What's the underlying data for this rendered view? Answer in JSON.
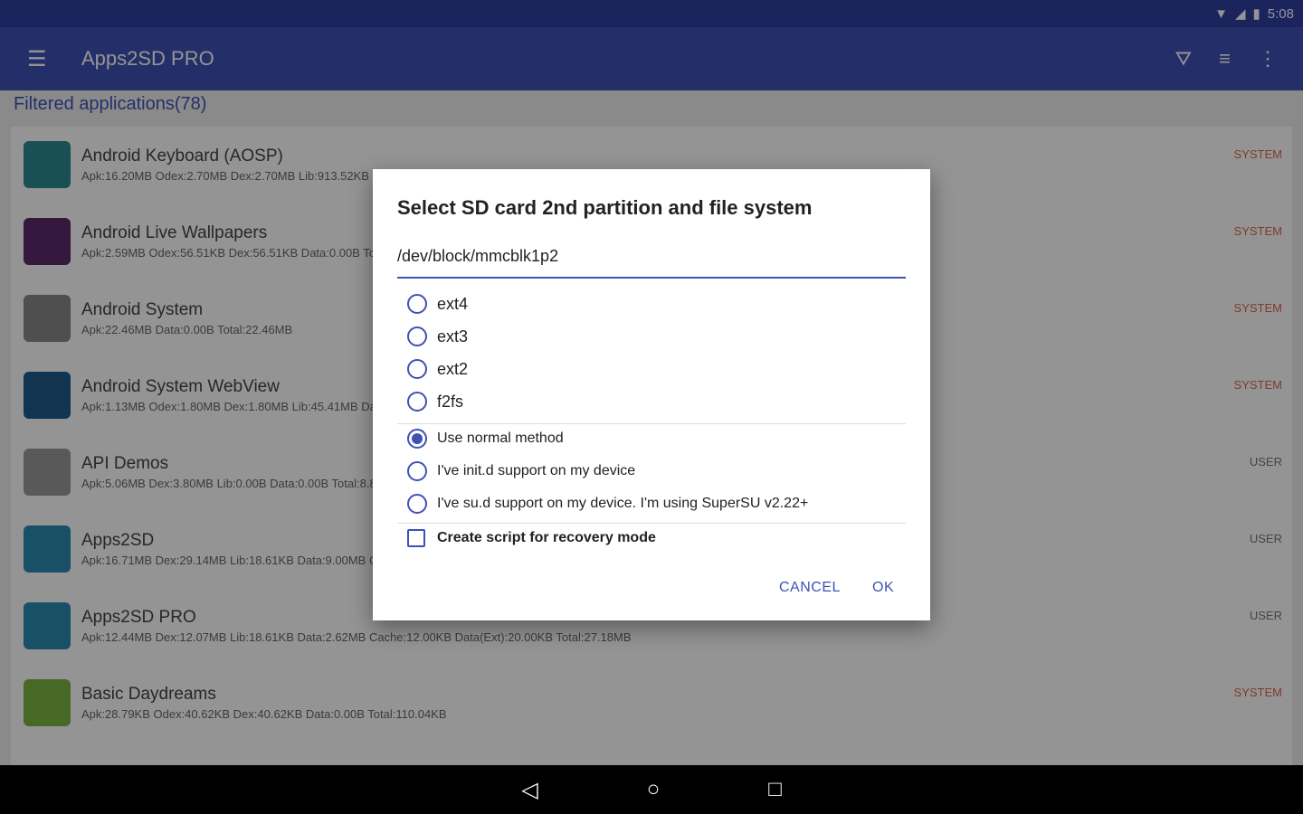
{
  "status": {
    "time": "5:08"
  },
  "appbar": {
    "title": "Apps2SD PRO"
  },
  "subheader": "Filtered applications(78)",
  "apps": [
    {
      "name": "Android Keyboard (AOSP)",
      "info": "Apk:16.20MB Odex:2.70MB Dex:2.70MB Lib:913.52KB",
      "tag": "SYSTEM",
      "color": "#2a8a8f"
    },
    {
      "name": "Android Live Wallpapers",
      "info": "Apk:2.59MB Odex:56.51KB Dex:56.51KB Data:0.00B To",
      "tag": "SYSTEM",
      "color": "#5a2a6a"
    },
    {
      "name": "Android System",
      "info": "Apk:22.46MB Data:0.00B Total:22.46MB",
      "tag": "SYSTEM",
      "color": "#888888"
    },
    {
      "name": "Android System WebView",
      "info": "Apk:1.13MB Odex:1.80MB Dex:1.80MB Lib:45.41MB Da",
      "tag": "SYSTEM",
      "color": "#1e5a8a"
    },
    {
      "name": "API Demos",
      "info": "Apk:5.06MB Dex:3.80MB Lib:0.00B Data:0.00B Total:8.8",
      "tag": "USER",
      "color": "#9a9a9a"
    },
    {
      "name": "Apps2SD",
      "info": "Apk:16.71MB Dex:29.14MB Lib:18.61KB Data:9.00MB C",
      "tag": "USER",
      "color": "#2a8ab0"
    },
    {
      "name": "Apps2SD PRO",
      "info": "Apk:12.44MB Dex:12.07MB Lib:18.61KB Data:2.62MB Cache:12.00KB Data(Ext):20.00KB Total:27.18MB",
      "tag": "USER",
      "color": "#2a8ab0"
    },
    {
      "name": "Basic Daydreams",
      "info": "Apk:28.79KB Odex:40.62KB Dex:40.62KB Data:0.00B Total:110.04KB",
      "tag": "SYSTEM",
      "color": "#7cb342"
    }
  ],
  "dialog": {
    "title": "Select SD card 2nd partition and file system",
    "path": "/dev/block/mmcblk1p2",
    "fs": [
      "ext4",
      "ext3",
      "ext2",
      "f2fs"
    ],
    "methods": [
      "Use normal method",
      "I've init.d support on my device",
      "I've su.d support on my device. I'm using SuperSU v2.22+"
    ],
    "selected_method": 0,
    "checkbox": "Create script for recovery mode",
    "checked": false,
    "cancel": "CANCEL",
    "ok": "OK"
  }
}
